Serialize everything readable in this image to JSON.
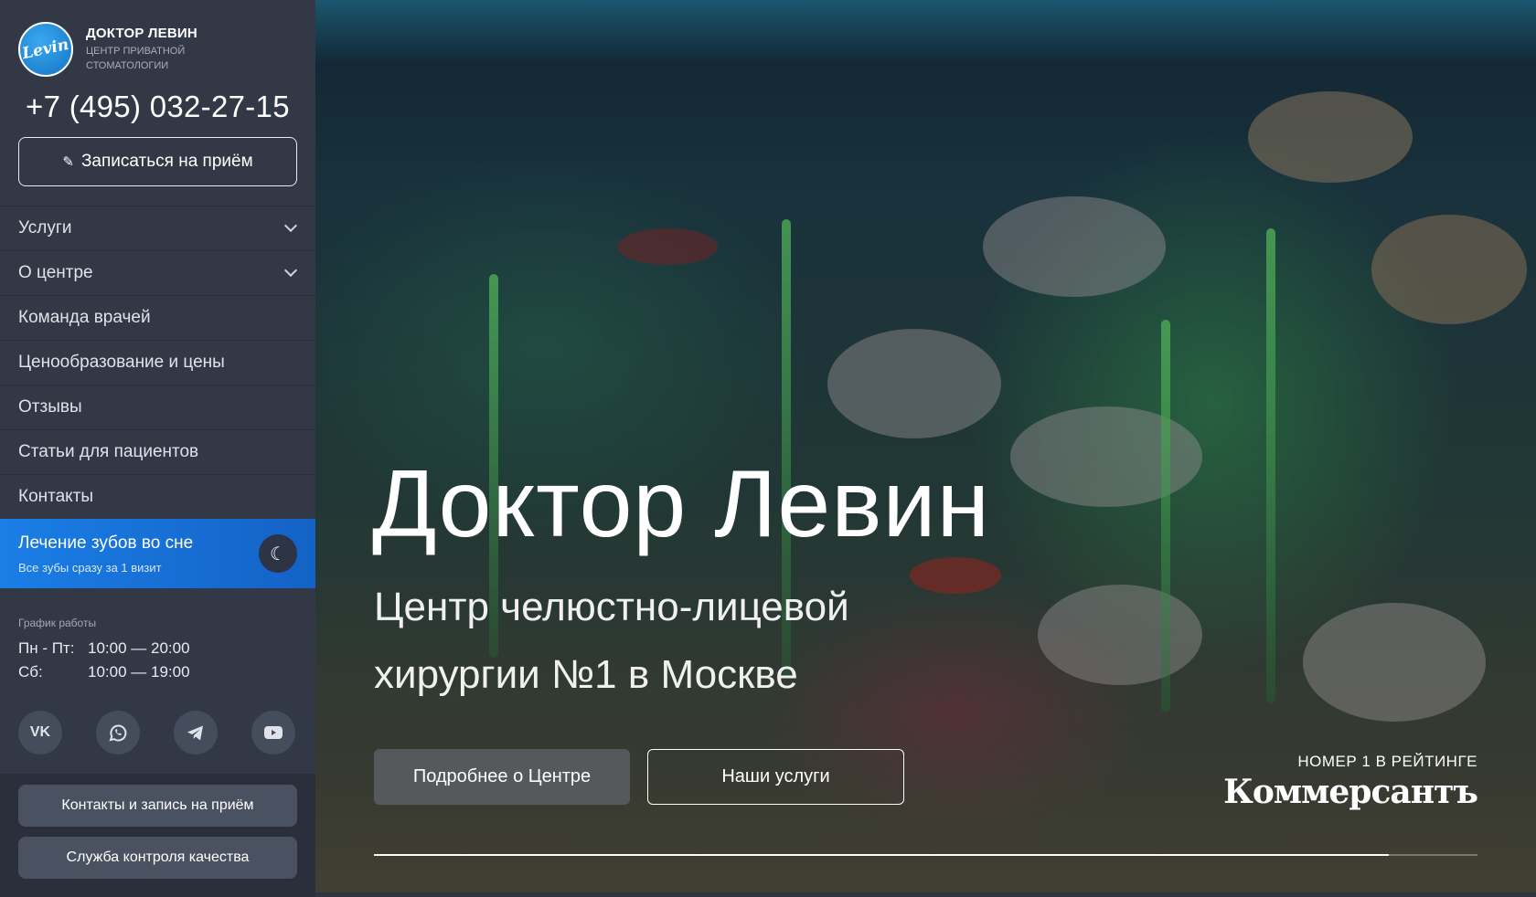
{
  "brand": {
    "name": "ДОКТОР ЛЕВИН",
    "subtitle_line1": "ЦЕНТР ПРИВАТНОЙ",
    "subtitle_line2": "СТОМАТОЛОГИИ",
    "logo_text": "Levin",
    "accent_color": "#1a7ee6"
  },
  "phone": "+7 (495) 032-27-15",
  "book_button": {
    "label": "Записаться на приём",
    "icon": "pen-icon"
  },
  "menu": [
    {
      "label": "Услуги",
      "has_submenu": true
    },
    {
      "label": "О центре",
      "has_submenu": true
    },
    {
      "label": "Команда врачей",
      "has_submenu": false
    },
    {
      "label": "Ценообразование и цены",
      "has_submenu": false
    },
    {
      "label": "Отзывы",
      "has_submenu": false
    },
    {
      "label": "Статьи для пациентов",
      "has_submenu": false
    },
    {
      "label": "Контакты",
      "has_submenu": false
    }
  ],
  "promo": {
    "title": "Лечение зубов во сне",
    "subtitle": "Все зубы сразу за 1 визит",
    "icon": "moon-icon"
  },
  "schedule": {
    "label": "График работы",
    "rows": [
      {
        "day": "Пн - Пт:",
        "hours": "10:00 — 20:00"
      },
      {
        "day": "Сб:",
        "hours": "10:00 — 19:00"
      }
    ]
  },
  "socials": [
    {
      "name": "vk-icon",
      "glyph": "VK"
    },
    {
      "name": "whatsapp-icon"
    },
    {
      "name": "telegram-icon"
    },
    {
      "name": "youtube-icon"
    }
  ],
  "bottom_buttons": {
    "contacts": "Контакты и запись на приём",
    "quality": "Служба контроля качества"
  },
  "hero": {
    "title": "Доктор Левин",
    "subtitle": "Центр челюстно-лицевой хирургии №1 в Москве",
    "button_about": "Подробнее о Центре",
    "button_services": "Наши услуги",
    "rating_label": "НОМЕР 1 В РЕЙТИНГЕ",
    "rating_brand": "Коммерсантъ",
    "slide_progress": 0.92
  }
}
